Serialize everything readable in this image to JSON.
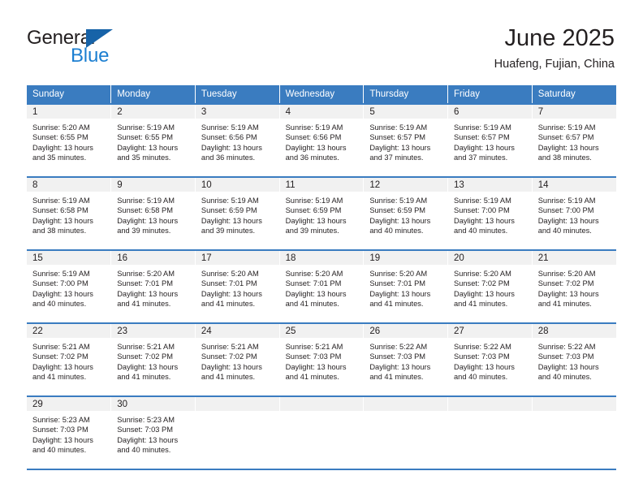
{
  "brand": {
    "name_part1": "General",
    "name_part2": "Blue",
    "accent_color": "#1c7fd1",
    "triangle_color": "#1763a8"
  },
  "header": {
    "title": "June 2025",
    "subtitle": "Huafeng, Fujian, China"
  },
  "theme": {
    "header_bg": "#3a7cc0",
    "daynum_bg": "#f1f1f1",
    "text_color": "#231f20"
  },
  "calendar": {
    "weekday_headers": [
      "Sunday",
      "Monday",
      "Tuesday",
      "Wednesday",
      "Thursday",
      "Friday",
      "Saturday"
    ],
    "weeks": [
      [
        {
          "day": "1",
          "sunrise": "Sunrise: 5:20 AM",
          "sunset": "Sunset: 6:55 PM",
          "daylight1": "Daylight: 13 hours",
          "daylight2": "and 35 minutes."
        },
        {
          "day": "2",
          "sunrise": "Sunrise: 5:19 AM",
          "sunset": "Sunset: 6:55 PM",
          "daylight1": "Daylight: 13 hours",
          "daylight2": "and 35 minutes."
        },
        {
          "day": "3",
          "sunrise": "Sunrise: 5:19 AM",
          "sunset": "Sunset: 6:56 PM",
          "daylight1": "Daylight: 13 hours",
          "daylight2": "and 36 minutes."
        },
        {
          "day": "4",
          "sunrise": "Sunrise: 5:19 AM",
          "sunset": "Sunset: 6:56 PM",
          "daylight1": "Daylight: 13 hours",
          "daylight2": "and 36 minutes."
        },
        {
          "day": "5",
          "sunrise": "Sunrise: 5:19 AM",
          "sunset": "Sunset: 6:57 PM",
          "daylight1": "Daylight: 13 hours",
          "daylight2": "and 37 minutes."
        },
        {
          "day": "6",
          "sunrise": "Sunrise: 5:19 AM",
          "sunset": "Sunset: 6:57 PM",
          "daylight1": "Daylight: 13 hours",
          "daylight2": "and 37 minutes."
        },
        {
          "day": "7",
          "sunrise": "Sunrise: 5:19 AM",
          "sunset": "Sunset: 6:57 PM",
          "daylight1": "Daylight: 13 hours",
          "daylight2": "and 38 minutes."
        }
      ],
      [
        {
          "day": "8",
          "sunrise": "Sunrise: 5:19 AM",
          "sunset": "Sunset: 6:58 PM",
          "daylight1": "Daylight: 13 hours",
          "daylight2": "and 38 minutes."
        },
        {
          "day": "9",
          "sunrise": "Sunrise: 5:19 AM",
          "sunset": "Sunset: 6:58 PM",
          "daylight1": "Daylight: 13 hours",
          "daylight2": "and 39 minutes."
        },
        {
          "day": "10",
          "sunrise": "Sunrise: 5:19 AM",
          "sunset": "Sunset: 6:59 PM",
          "daylight1": "Daylight: 13 hours",
          "daylight2": "and 39 minutes."
        },
        {
          "day": "11",
          "sunrise": "Sunrise: 5:19 AM",
          "sunset": "Sunset: 6:59 PM",
          "daylight1": "Daylight: 13 hours",
          "daylight2": "and 39 minutes."
        },
        {
          "day": "12",
          "sunrise": "Sunrise: 5:19 AM",
          "sunset": "Sunset: 6:59 PM",
          "daylight1": "Daylight: 13 hours",
          "daylight2": "and 40 minutes."
        },
        {
          "day": "13",
          "sunrise": "Sunrise: 5:19 AM",
          "sunset": "Sunset: 7:00 PM",
          "daylight1": "Daylight: 13 hours",
          "daylight2": "and 40 minutes."
        },
        {
          "day": "14",
          "sunrise": "Sunrise: 5:19 AM",
          "sunset": "Sunset: 7:00 PM",
          "daylight1": "Daylight: 13 hours",
          "daylight2": "and 40 minutes."
        }
      ],
      [
        {
          "day": "15",
          "sunrise": "Sunrise: 5:19 AM",
          "sunset": "Sunset: 7:00 PM",
          "daylight1": "Daylight: 13 hours",
          "daylight2": "and 40 minutes."
        },
        {
          "day": "16",
          "sunrise": "Sunrise: 5:20 AM",
          "sunset": "Sunset: 7:01 PM",
          "daylight1": "Daylight: 13 hours",
          "daylight2": "and 41 minutes."
        },
        {
          "day": "17",
          "sunrise": "Sunrise: 5:20 AM",
          "sunset": "Sunset: 7:01 PM",
          "daylight1": "Daylight: 13 hours",
          "daylight2": "and 41 minutes."
        },
        {
          "day": "18",
          "sunrise": "Sunrise: 5:20 AM",
          "sunset": "Sunset: 7:01 PM",
          "daylight1": "Daylight: 13 hours",
          "daylight2": "and 41 minutes."
        },
        {
          "day": "19",
          "sunrise": "Sunrise: 5:20 AM",
          "sunset": "Sunset: 7:01 PM",
          "daylight1": "Daylight: 13 hours",
          "daylight2": "and 41 minutes."
        },
        {
          "day": "20",
          "sunrise": "Sunrise: 5:20 AM",
          "sunset": "Sunset: 7:02 PM",
          "daylight1": "Daylight: 13 hours",
          "daylight2": "and 41 minutes."
        },
        {
          "day": "21",
          "sunrise": "Sunrise: 5:20 AM",
          "sunset": "Sunset: 7:02 PM",
          "daylight1": "Daylight: 13 hours",
          "daylight2": "and 41 minutes."
        }
      ],
      [
        {
          "day": "22",
          "sunrise": "Sunrise: 5:21 AM",
          "sunset": "Sunset: 7:02 PM",
          "daylight1": "Daylight: 13 hours",
          "daylight2": "and 41 minutes."
        },
        {
          "day": "23",
          "sunrise": "Sunrise: 5:21 AM",
          "sunset": "Sunset: 7:02 PM",
          "daylight1": "Daylight: 13 hours",
          "daylight2": "and 41 minutes."
        },
        {
          "day": "24",
          "sunrise": "Sunrise: 5:21 AM",
          "sunset": "Sunset: 7:02 PM",
          "daylight1": "Daylight: 13 hours",
          "daylight2": "and 41 minutes."
        },
        {
          "day": "25",
          "sunrise": "Sunrise: 5:21 AM",
          "sunset": "Sunset: 7:03 PM",
          "daylight1": "Daylight: 13 hours",
          "daylight2": "and 41 minutes."
        },
        {
          "day": "26",
          "sunrise": "Sunrise: 5:22 AM",
          "sunset": "Sunset: 7:03 PM",
          "daylight1": "Daylight: 13 hours",
          "daylight2": "and 41 minutes."
        },
        {
          "day": "27",
          "sunrise": "Sunrise: 5:22 AM",
          "sunset": "Sunset: 7:03 PM",
          "daylight1": "Daylight: 13 hours",
          "daylight2": "and 40 minutes."
        },
        {
          "day": "28",
          "sunrise": "Sunrise: 5:22 AM",
          "sunset": "Sunset: 7:03 PM",
          "daylight1": "Daylight: 13 hours",
          "daylight2": "and 40 minutes."
        }
      ],
      [
        {
          "day": "29",
          "sunrise": "Sunrise: 5:23 AM",
          "sunset": "Sunset: 7:03 PM",
          "daylight1": "Daylight: 13 hours",
          "daylight2": "and 40 minutes."
        },
        {
          "day": "30",
          "sunrise": "Sunrise: 5:23 AM",
          "sunset": "Sunset: 7:03 PM",
          "daylight1": "Daylight: 13 hours",
          "daylight2": "and 40 minutes."
        },
        {
          "day": "",
          "sunrise": "",
          "sunset": "",
          "daylight1": "",
          "daylight2": ""
        },
        {
          "day": "",
          "sunrise": "",
          "sunset": "",
          "daylight1": "",
          "daylight2": ""
        },
        {
          "day": "",
          "sunrise": "",
          "sunset": "",
          "daylight1": "",
          "daylight2": ""
        },
        {
          "day": "",
          "sunrise": "",
          "sunset": "",
          "daylight1": "",
          "daylight2": ""
        },
        {
          "day": "",
          "sunrise": "",
          "sunset": "",
          "daylight1": "",
          "daylight2": ""
        }
      ]
    ]
  }
}
